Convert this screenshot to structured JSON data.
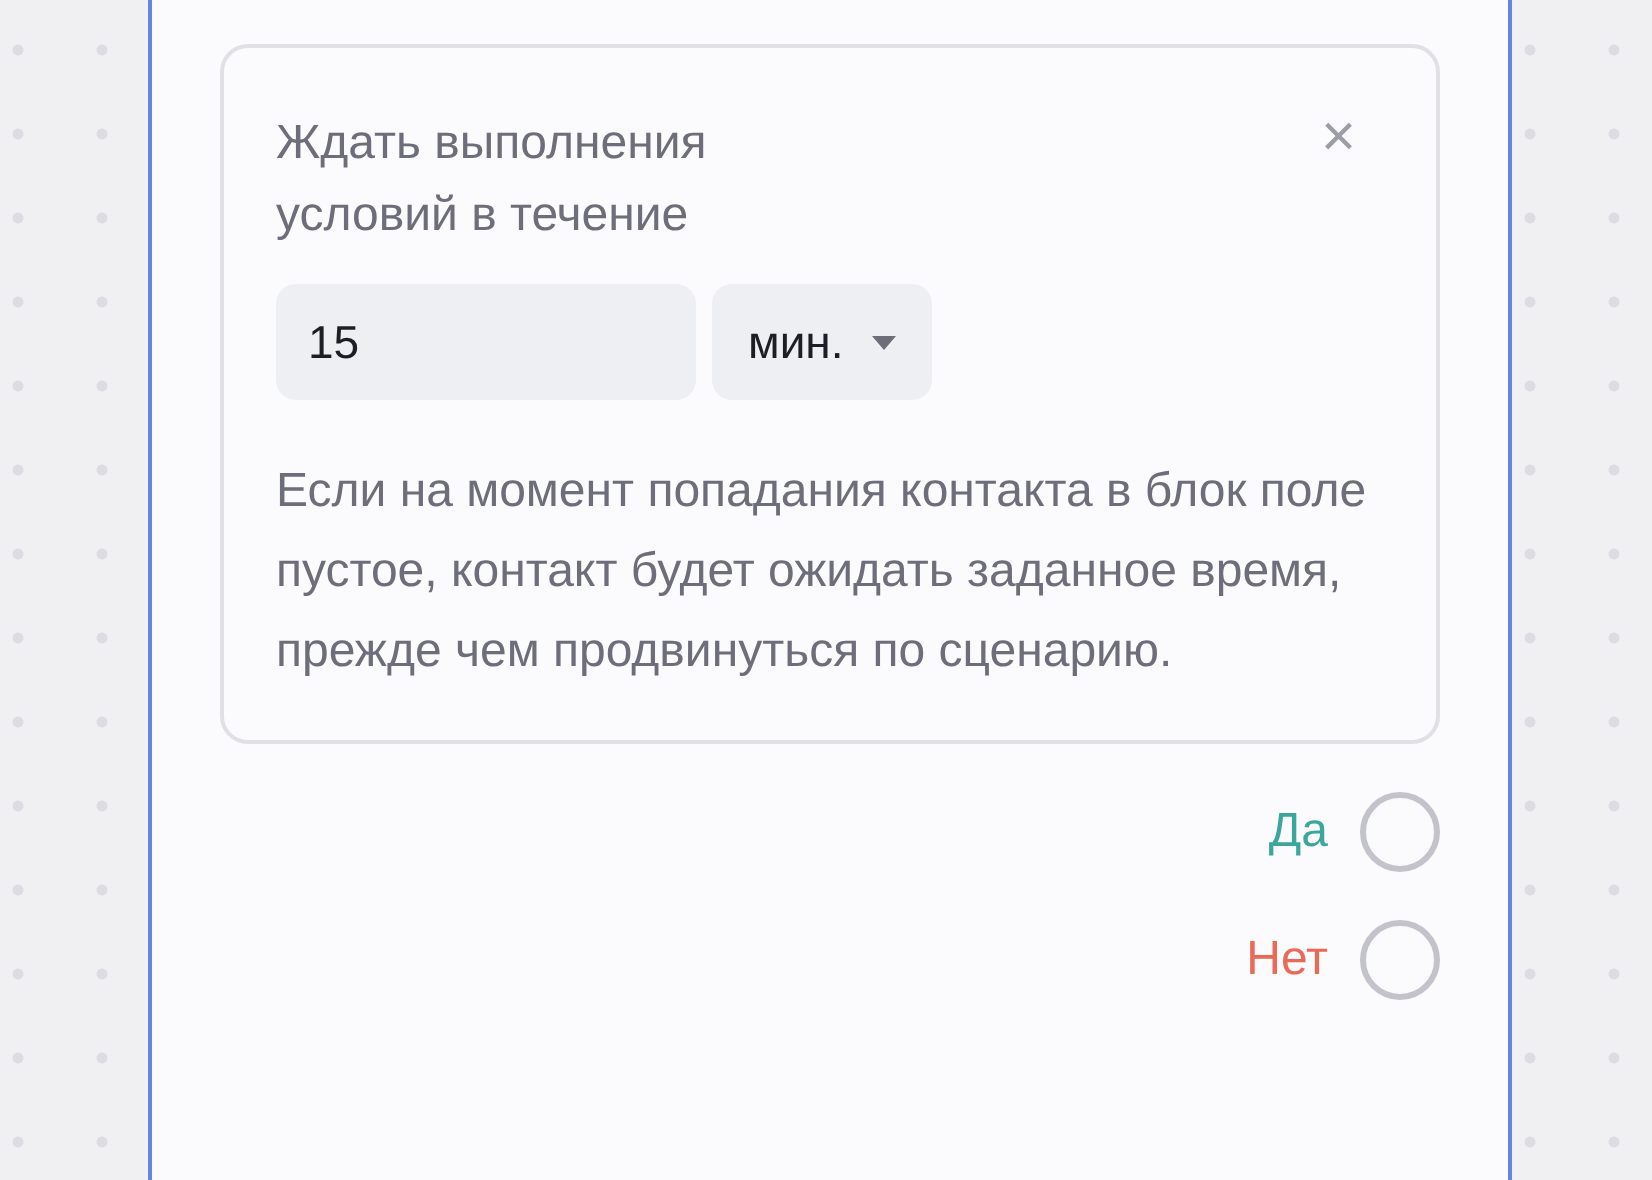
{
  "condition_panel": {
    "title": "Ждать выполнения условий в течение",
    "close": "×",
    "duration": {
      "value": "15"
    },
    "unit": {
      "value": "мин."
    },
    "description": "Если на момент попадания контакта в блок поле пустое, контакт будет ожидать заданное время, прежде чем продвинуться по сценарию."
  },
  "outputs": [
    {
      "label": "Да",
      "color": "#3aa79a"
    },
    {
      "label": "Нет",
      "color": "#ea6a58"
    }
  ]
}
